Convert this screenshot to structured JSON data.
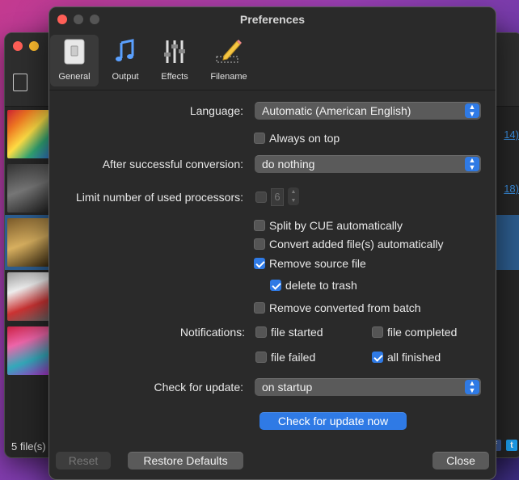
{
  "background_window": {
    "status_text": "5 file(s)",
    "links": [
      "14)",
      "18)"
    ]
  },
  "window": {
    "title": "Preferences"
  },
  "toolbar": {
    "tabs": [
      {
        "label": "General",
        "icon": "general-icon",
        "selected": true
      },
      {
        "label": "Output",
        "icon": "music-note-icon",
        "selected": false
      },
      {
        "label": "Effects",
        "icon": "sliders-icon",
        "selected": false
      },
      {
        "label": "Filename",
        "icon": "pencil-icon",
        "selected": false
      }
    ]
  },
  "general": {
    "language": {
      "label": "Language:",
      "value": "Automatic (American English)"
    },
    "always_on_top": {
      "label": "Always on top",
      "checked": false
    },
    "after_conversion": {
      "label": "After successful conversion:",
      "value": "do nothing"
    },
    "processors": {
      "label": "Limit number of used processors:",
      "checked": false,
      "value": "6"
    },
    "split_cue": {
      "label": "Split by CUE automatically",
      "checked": false
    },
    "convert_added": {
      "label": "Convert added file(s) automatically",
      "checked": false
    },
    "remove_source": {
      "label": "Remove source file",
      "checked": true
    },
    "delete_trash": {
      "label": "delete to trash",
      "checked": true
    },
    "remove_converted": {
      "label": "Remove converted from batch",
      "checked": false
    },
    "notifications": {
      "label": "Notifications:",
      "file_started": {
        "label": "file started",
        "checked": false
      },
      "file_completed": {
        "label": "file completed",
        "checked": false
      },
      "file_failed": {
        "label": "file failed",
        "checked": false
      },
      "all_finished": {
        "label": "all finished",
        "checked": true
      }
    },
    "check_update": {
      "label": "Check for update:",
      "value": "on startup"
    },
    "check_now_button": "Check for update now"
  },
  "footer": {
    "reset": "Reset",
    "restore_defaults": "Restore Defaults",
    "close": "Close"
  },
  "colors": {
    "accent": "#2f7ae5",
    "window_bg": "#2a2a2a",
    "close_light": "#ff5f57",
    "min_light": "#febc2e",
    "zoom_light": "#28c840"
  }
}
